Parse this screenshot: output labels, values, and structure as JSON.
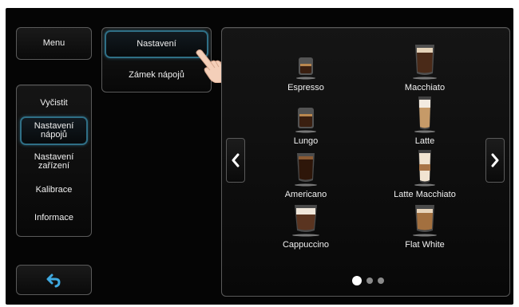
{
  "sidebar": {
    "menu_label": "Menu",
    "items": [
      {
        "label": "Vyčistit"
      },
      {
        "label": "Nastavení\nnápojů"
      },
      {
        "label": "Nastavení\nzařízení"
      },
      {
        "label": "Kalibrace"
      },
      {
        "label": "Informace"
      }
    ],
    "back_icon": "back-arrow-icon"
  },
  "submenu": {
    "items": [
      {
        "label": "Nastavení"
      },
      {
        "label": "Zámek nápojů"
      }
    ]
  },
  "drinks": [
    {
      "name": "Espresso"
    },
    {
      "name": "Macchiato"
    },
    {
      "name": "Lungo"
    },
    {
      "name": "Latte"
    },
    {
      "name": "Americano"
    },
    {
      "name": "Latte Macchiato"
    },
    {
      "name": "Cappuccino"
    },
    {
      "name": "Flat White"
    }
  ],
  "pagination": {
    "current": 1,
    "total": 3
  },
  "colors": {
    "accent": "#2f6f86",
    "back_icon": "#3fa9e0"
  }
}
